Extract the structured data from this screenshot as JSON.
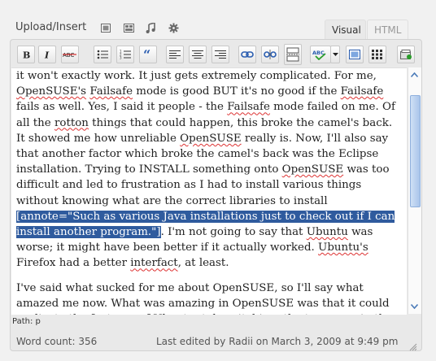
{
  "header": {
    "upload_label": "Upload/Insert",
    "media_icons": [
      "image-icon",
      "video-icon",
      "music-icon",
      "media-gear-icon"
    ],
    "tabs": [
      {
        "label": "Visual",
        "active": true
      },
      {
        "label": "HTML",
        "active": false
      }
    ]
  },
  "toolbar": {
    "buttons": [
      "bold",
      "italic",
      "strikethrough",
      "bullet-list",
      "numbered-list",
      "blockquote",
      "align-left",
      "align-center",
      "align-right",
      "link",
      "unlink",
      "more-tag",
      "spellcheck",
      "fullscreen",
      "kitchen-sink",
      "add-media"
    ]
  },
  "content": {
    "p1": {
      "s1": "it won't exactly work. It just gets extremely complicated. For me,",
      "w_opensuse1": "OpenSUSE's",
      "s2": " ",
      "w_failsafe1": "Failsafe",
      "s3": " mode is good BUT it's no good if the ",
      "w_failsafe2": "Failsafe",
      "s4": " fails as well. Yes, I said it people - the ",
      "w_failsafe3": "Failsafe",
      "s5": " mode failed on me. Of all the ",
      "w_rotton": "rotton",
      "s6": " things that could happen, this broke the camel's back. It showed me how unreliable ",
      "w_opensuse2": "OpenSUSE",
      "s7": " really is. Now, I'll also say that another factor which broke the camel's back was the Eclipse installation. Trying to INSTALL something onto ",
      "w_opensuse3": "OpenSUSE",
      "s8": " was too difficult and led to frustration as I had to install various things without knowing what are the correct libraries to install ",
      "selected": "[annote=\"Such as various Java installations just to check out if I can install another program.\"]",
      "s9": ". I'm not going to say that ",
      "w_ubuntu1": "Ubuntu",
      "s10": " was worse; it might have been better if it actually worked. ",
      "w_ubuntu2": "Ubuntu's",
      "s11": " Firefox had a better ",
      "w_interfact": "interfact",
      "s12": ", at least."
    },
    "p2": "I've said what sucked for me about OpenSUSE, so I'll say what amazed me now. What was amazing in OpenSUSE was that it could replicate the features of Ubuntu; tab switching, the top menu in the desktop, etc. It's fit to be a GUI"
  },
  "path": "Path: p",
  "status": {
    "word_count": "Word count: 356",
    "last_edited": "Last edited by Radii on March 3, 2009 at 9:49 pm"
  },
  "colors": {
    "selection": "#2f5b9e",
    "spell_error": "#d33",
    "scroll_accent": "#4a7ab8"
  }
}
